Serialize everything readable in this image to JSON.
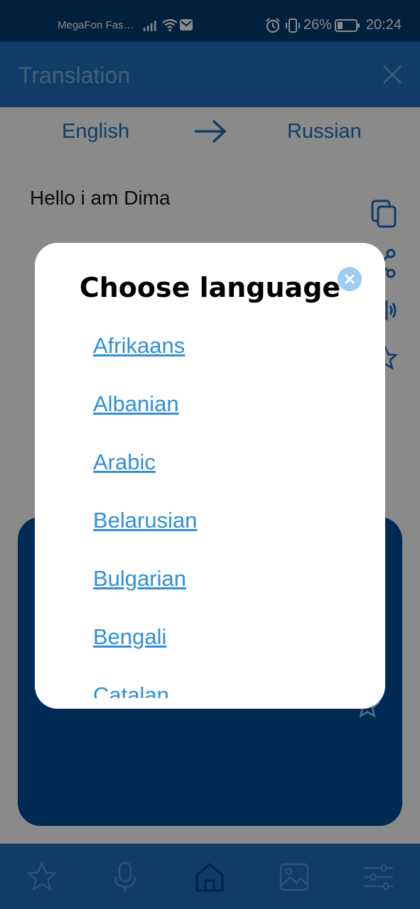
{
  "status_bar": {
    "carrier": "MegaFon Fas…",
    "battery": "26%",
    "time": "20:24"
  },
  "app_bar": {
    "title": "Translation"
  },
  "languages": {
    "source": "English",
    "target": "Russian"
  },
  "input": {
    "text": "Hello i am Dima"
  },
  "dialog": {
    "title": "Choose language",
    "languages": [
      "Afrikaans",
      "Albanian",
      "Arabic",
      "Belarusian",
      "Bulgarian",
      "Bengali",
      "Catalan"
    ]
  },
  "colors": {
    "primary": "#1e6fbf",
    "dark": "#003b73",
    "link": "#2f8fd8",
    "card": "#004d99"
  }
}
